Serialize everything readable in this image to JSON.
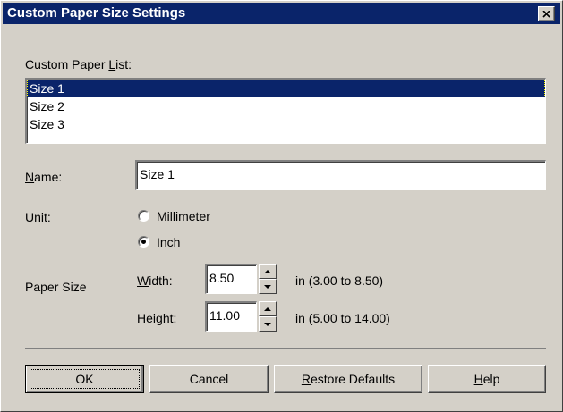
{
  "window": {
    "title": "Custom Paper Size Settings",
    "close_glyph": "×"
  },
  "paper_list": {
    "label_pre": "Custom Paper ",
    "label_accel": "L",
    "label_post": "ist:",
    "items": [
      {
        "label": "Size 1",
        "selected": true
      },
      {
        "label": "Size 2",
        "selected": false
      },
      {
        "label": "Size 3",
        "selected": false
      }
    ]
  },
  "name": {
    "label_accel": "N",
    "label_post": "ame:",
    "value": "Size 1"
  },
  "unit": {
    "label_accel": "U",
    "label_post": "nit:",
    "options": [
      {
        "label": "Millimeter",
        "checked": false
      },
      {
        "label": "Inch",
        "checked": true
      }
    ]
  },
  "paper_size": {
    "label": "Paper Size",
    "width": {
      "label_accel": "W",
      "label_post": "idth:",
      "value": "8.50",
      "range": "in (3.00 to 8.50)"
    },
    "height": {
      "label_pre": "H",
      "label_accel": "e",
      "label_post": "ight:",
      "value": "11.00",
      "range": "in (5.00 to 14.00)"
    }
  },
  "buttons": {
    "ok": "OK",
    "cancel": "Cancel",
    "restore_accel": "R",
    "restore_post": "estore Defaults",
    "help_accel": "H",
    "help_post": "elp"
  },
  "colors": {
    "titlebar": "#0a246a",
    "face": "#d4d0c8",
    "selection": "#0a246a"
  }
}
